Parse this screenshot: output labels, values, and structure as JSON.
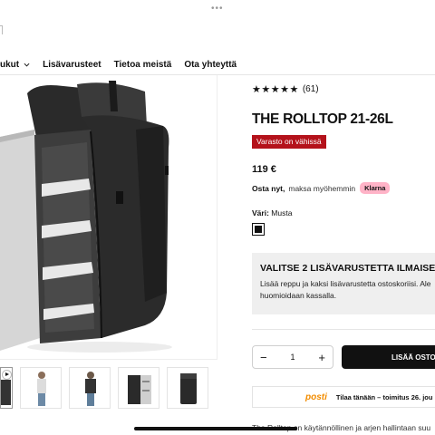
{
  "top_dots": "•••",
  "nav": {
    "items": [
      {
        "label": "ukut",
        "has_chevron": true
      },
      {
        "label": "Lisävarusteet"
      },
      {
        "label": "Tietoa meistä"
      },
      {
        "label": "Ota yhteyttä"
      }
    ]
  },
  "product": {
    "rating_stars": "★★★★★",
    "rating_count": "(61)",
    "title": "THE ROLLTOP 21-26L",
    "stock_badge": "Varasto on vähissä",
    "price": "119 €",
    "klarna": {
      "bold": "Osta nyt,",
      "text": "maksa myöhemmin",
      "badge": "Klarna"
    },
    "color_label": "Väri:",
    "color_value": "Musta",
    "promo": {
      "heading": "VALITSE 2 LISÄVARUSTETTA ILMAISE",
      "line1": "Lisää reppu ja kaksi lisävarustetta ostoskoriisi. Ale",
      "line2": "huomioidaan kassalla."
    },
    "quantity": {
      "minus": "−",
      "value": "1",
      "plus": "+"
    },
    "add_to_cart": "LISÄÄ OSTO",
    "shipping": {
      "carrier": "posti",
      "bold": "Tilaa tänään – toimitus 26. jou"
    },
    "description": "The Rolltop on käytännöllinen ja arjen hallintaan suu"
  },
  "colors": {
    "stock_badge_bg": "#b4121b",
    "klarna_pink": "#ffb3c7",
    "posti_orange": "#f28c00",
    "primary_button": "#111111"
  }
}
